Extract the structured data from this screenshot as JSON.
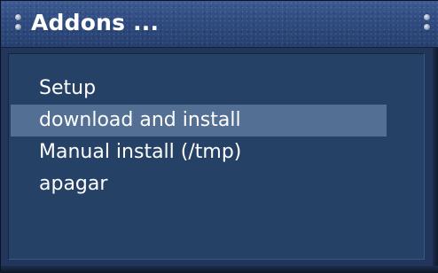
{
  "window": {
    "title": "Addons ..."
  },
  "menu": {
    "items": [
      {
        "label": "Setup",
        "selected": false
      },
      {
        "label": "download and install",
        "selected": true
      },
      {
        "label": "Manual install (/tmp)",
        "selected": false
      },
      {
        "label": "apagar",
        "selected": false
      }
    ]
  },
  "colors": {
    "background": "#22355a",
    "titlebar": "#2f4b80",
    "selection": "#536f94",
    "text": "#ffffff"
  }
}
